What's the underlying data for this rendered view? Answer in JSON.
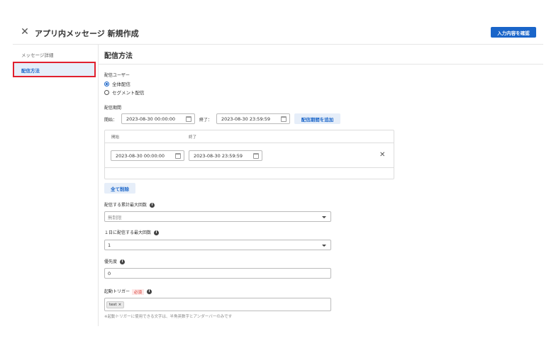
{
  "header": {
    "title": "アプリ内メッセージ 新規作成",
    "confirm_label": "入力内容を確認",
    "close_glyph": "✕"
  },
  "sidebar": {
    "items": [
      {
        "label": "メッセージ詳細"
      },
      {
        "label": "配信方法"
      }
    ]
  },
  "section": {
    "title": "配信方法",
    "delivery_user": {
      "label": "配信ユーザー",
      "options": [
        {
          "label": "全体配信",
          "checked": true
        },
        {
          "label": "セグメント配信",
          "checked": false
        }
      ]
    },
    "period": {
      "label": "配信期間",
      "start_label": "開始：",
      "start_value": "2023-08-30 00:00:00",
      "end_label": "終了：",
      "end_value": "2023-08-30 23:59:59",
      "add_label": "配信期間を追加",
      "table": {
        "headers": [
          "開始",
          "終了"
        ],
        "rows": [
          {
            "start": "2023-08-30 00:00:00",
            "end": "2023-08-30 23:59:59"
          }
        ]
      },
      "delete_all_label": "全て削除"
    },
    "max_total": {
      "label": "配信する累計最大回数",
      "value": "無制限"
    },
    "max_daily": {
      "label": "１日に配信する最大回数",
      "value": "1"
    },
    "priority": {
      "label": "優先度",
      "value": "0"
    },
    "trigger": {
      "label": "起動トリガー",
      "required": "必須",
      "tag": "test",
      "tag_close": "×",
      "hint": "※起動トリガーに使用できる文字は、半角英数字とアンダーバーのみです"
    }
  },
  "colors": {
    "accent": "#1a65c9",
    "highlight_border": "#e0202e",
    "selected_bg": "#e6eef9"
  }
}
